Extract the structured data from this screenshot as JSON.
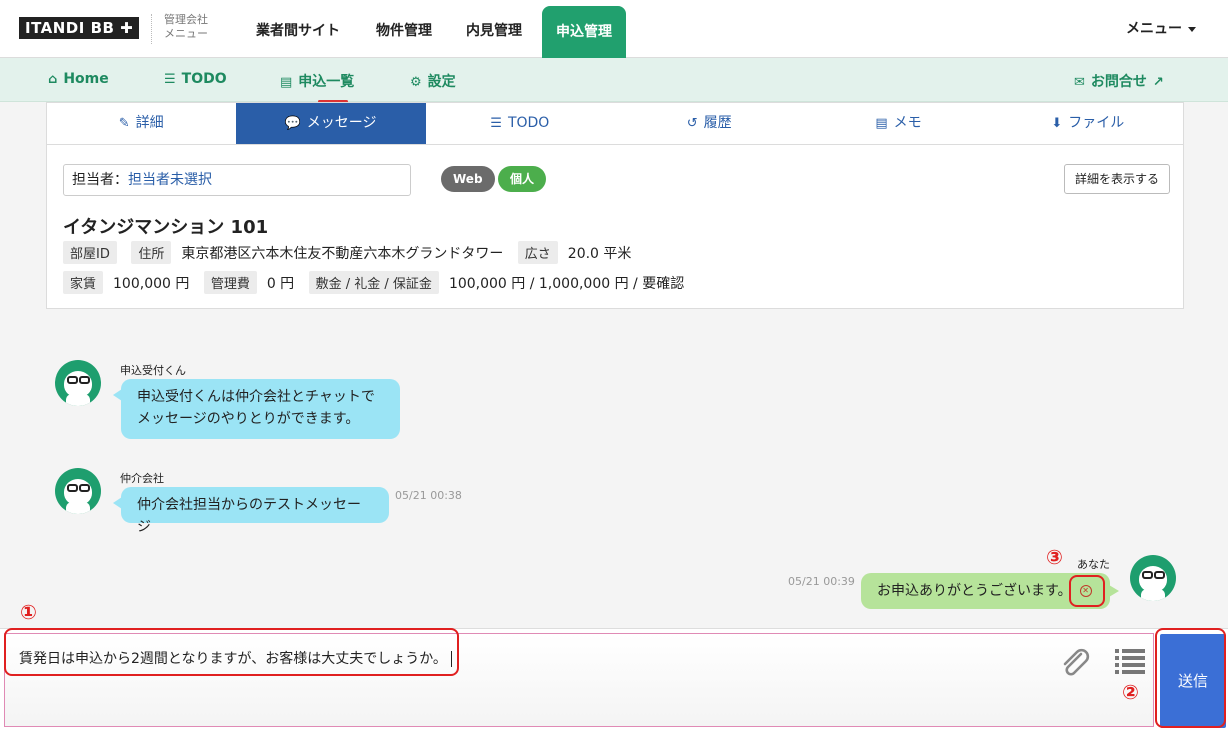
{
  "header": {
    "logo": "ITANDI BB ✚",
    "sub_line1": "管理会社",
    "sub_line2": "メニュー",
    "nav": [
      "業者間サイト",
      "物件管理",
      "内見管理",
      "申込管理"
    ],
    "menu": "メニュー"
  },
  "subnav": {
    "home": "Home",
    "todo": "TODO",
    "list": "申込一覧",
    "settings": "設定",
    "contact": "お問合せ"
  },
  "tabs": [
    "詳細",
    "メッセージ",
    "TODO",
    "履歴",
    "メモ",
    "ファイル"
  ],
  "panel": {
    "assignee_label": "担当者：",
    "assignee_value": "担当者未選択",
    "badge_web": "Web",
    "badge_individual": "個人",
    "detail_button": "詳細を表示する",
    "property_name": "イタンジマンション 101",
    "room_id_label": "部屋ID",
    "address_label": "住所",
    "address": "東京都港区六本木住友不動産六本木グランドタワー",
    "area_label": "広さ",
    "area": "20.0 平米",
    "rent_label": "家賃",
    "rent": "100,000 円",
    "mgmt_label": "管理費",
    "mgmt": "0 円",
    "deposit_label": "敷金 / 礼金 / 保証金",
    "deposit": "100,000 円 / 1,000,000 円 / 要確認"
  },
  "messages": {
    "m1_sender": "申込受付くん",
    "m1_line1": "申込受付くんは仲介会社とチャットで",
    "m1_line2": "メッセージのやりとりができます。",
    "m2_sender": "仲介会社",
    "m2_text": "仲介会社担当からのテストメッセージ",
    "m2_time": "05/21 00:38",
    "m3_sender": "あなた",
    "m3_text": "お申込ありがとうございます。",
    "m3_time": "05/21 00:39"
  },
  "annotations": [
    "①",
    "②",
    "③"
  ],
  "input": {
    "value": "賃発日は申込から2週間となりますが、お客様は大丈夫でしょうか。",
    "send": "送信"
  },
  "colors": {
    "brand_green": "#21a06e",
    "tab_blue": "#2a5ea8",
    "bubble_blue": "#9be4f5",
    "bubble_green": "#b6e39a",
    "send_blue": "#3b6fd6",
    "annotation_red": "#e02020"
  }
}
